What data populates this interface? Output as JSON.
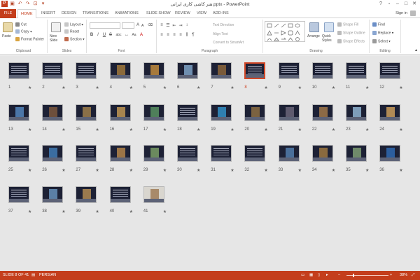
{
  "window": {
    "title": "هنر کاشی کاری ایرانی.pptx - PowerPoint",
    "minimize": "–",
    "maximize": "□",
    "close": "✕",
    "help": "?",
    "restore": "▫"
  },
  "tabs": {
    "file": "FILE",
    "items": [
      "HOME",
      "INSERT",
      "DESIGN",
      "TRANSITIONS",
      "ANIMATIONS",
      "SLIDE SHOW",
      "REVIEW",
      "VIEW",
      "ADD-INS"
    ],
    "active": "HOME",
    "signin": "Sign in"
  },
  "ribbon": {
    "clipboard": {
      "label": "Clipboard",
      "paste": "Paste",
      "cut": "Cut",
      "copy": "Copy",
      "format_painter": "Format Painter"
    },
    "slides": {
      "label": "Slides",
      "new_slide": "New Slide",
      "layout": "Layout",
      "reset": "Reset",
      "section": "Section"
    },
    "font": {
      "label": "Font",
      "size_up": "A",
      "size_down": "A",
      "bold": "B",
      "italic": "I",
      "underline": "U",
      "strike": "S",
      "shadow": "abc",
      "case": "Aa"
    },
    "paragraph": {
      "label": "Paragraph",
      "text_direction": "Text Direction",
      "align_text": "Align Text",
      "smartart": "Convert to SmartArt"
    },
    "drawing": {
      "label": "Drawing",
      "arrange": "Arrange",
      "quick_styles": "Quick Styles",
      "shape_fill": "Shape Fill",
      "shape_outline": "Shape Outline",
      "shape_effects": "Shape Effects"
    },
    "editing": {
      "label": "Editing",
      "find": "Find",
      "replace": "Replace",
      "select": "Select"
    }
  },
  "slides": [
    {
      "n": "1"
    },
    {
      "n": "2"
    },
    {
      "n": "3"
    },
    {
      "n": "4"
    },
    {
      "n": "5"
    },
    {
      "n": "6"
    },
    {
      "n": "7"
    },
    {
      "n": "8"
    },
    {
      "n": "9"
    },
    {
      "n": "10"
    },
    {
      "n": "11"
    },
    {
      "n": "12"
    },
    {
      "n": "13"
    },
    {
      "n": "14"
    },
    {
      "n": "15"
    },
    {
      "n": "16"
    },
    {
      "n": "17"
    },
    {
      "n": "18"
    },
    {
      "n": "19"
    },
    {
      "n": "20"
    },
    {
      "n": "21"
    },
    {
      "n": "22"
    },
    {
      "n": "23"
    },
    {
      "n": "24"
    },
    {
      "n": "25"
    },
    {
      "n": "26"
    },
    {
      "n": "27"
    },
    {
      "n": "28"
    },
    {
      "n": "29"
    },
    {
      "n": "30"
    },
    {
      "n": "31"
    },
    {
      "n": "32"
    },
    {
      "n": "33"
    },
    {
      "n": "34"
    },
    {
      "n": "35"
    },
    {
      "n": "36"
    },
    {
      "n": "37"
    },
    {
      "n": "38"
    },
    {
      "n": "39"
    },
    {
      "n": "40"
    },
    {
      "n": "41"
    }
  ],
  "selected_slide": "8",
  "star": "★",
  "status": {
    "slide_info": "SLIDE 8 OF 41",
    "language": "PERSIAN",
    "zoom": "38%",
    "zoom_minus": "–",
    "zoom_plus": "+"
  },
  "colors": {
    "accent": "#c43e1c",
    "selection": "#d04727",
    "sorter_bg": "#e6e6e6"
  }
}
